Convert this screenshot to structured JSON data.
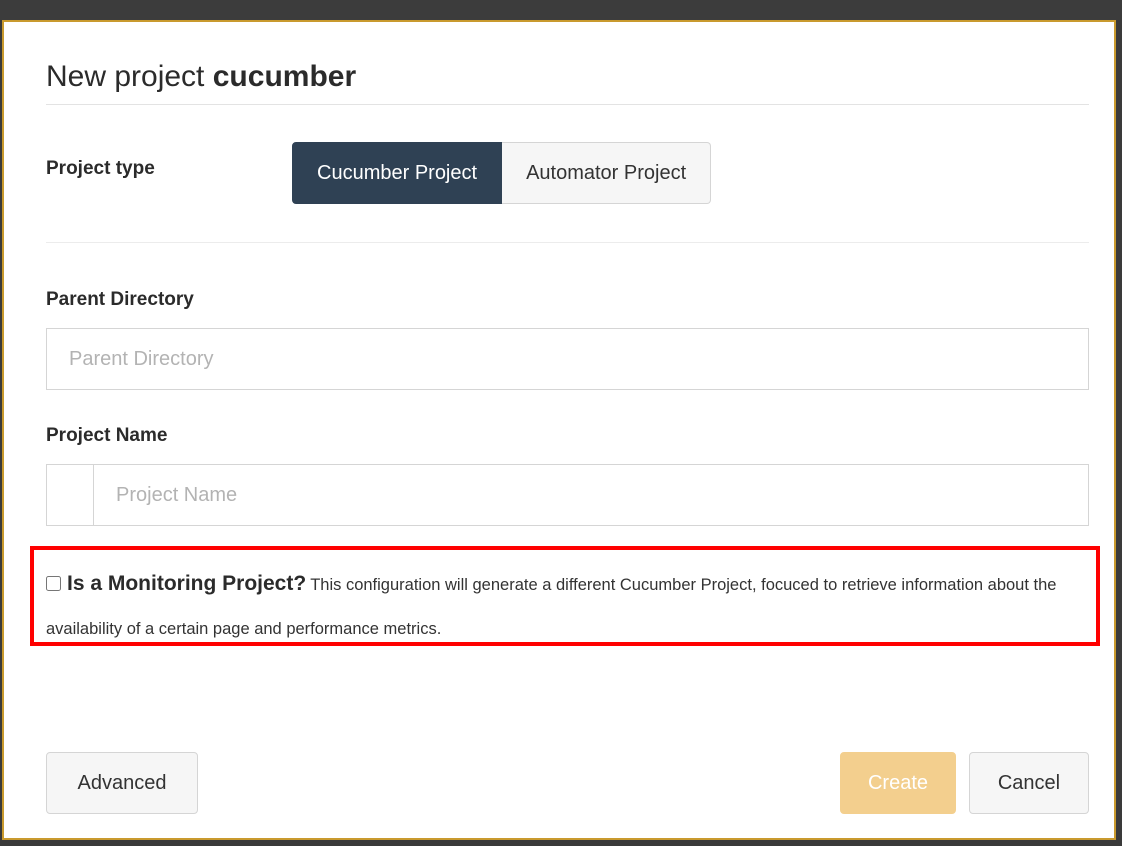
{
  "modal": {
    "title_prefix": "New project",
    "title_name": "cucumber"
  },
  "project_type": {
    "label": "Project type",
    "options": [
      "Cucumber Project",
      "Automator Project"
    ],
    "selected": "Cucumber Project"
  },
  "parent_directory": {
    "label": "Parent Directory",
    "placeholder": "Parent Directory",
    "value": ""
  },
  "project_name": {
    "label": "Project Name",
    "placeholder": "Project Name",
    "value": ""
  },
  "monitoring": {
    "checked": false,
    "label": "Is a Monitoring Project?",
    "description": "This configuration will generate a different Cucumber Project, focuced to retrieve information about the availability of a certain page and performance metrics."
  },
  "footer": {
    "advanced_label": "Advanced",
    "create_label": "Create",
    "cancel_label": "Cancel"
  },
  "colors": {
    "active_toggle": "#2f4154",
    "create_disabled": "#f3cf8e",
    "highlight": "#ff0000",
    "modal_border": "#c99a2e"
  }
}
